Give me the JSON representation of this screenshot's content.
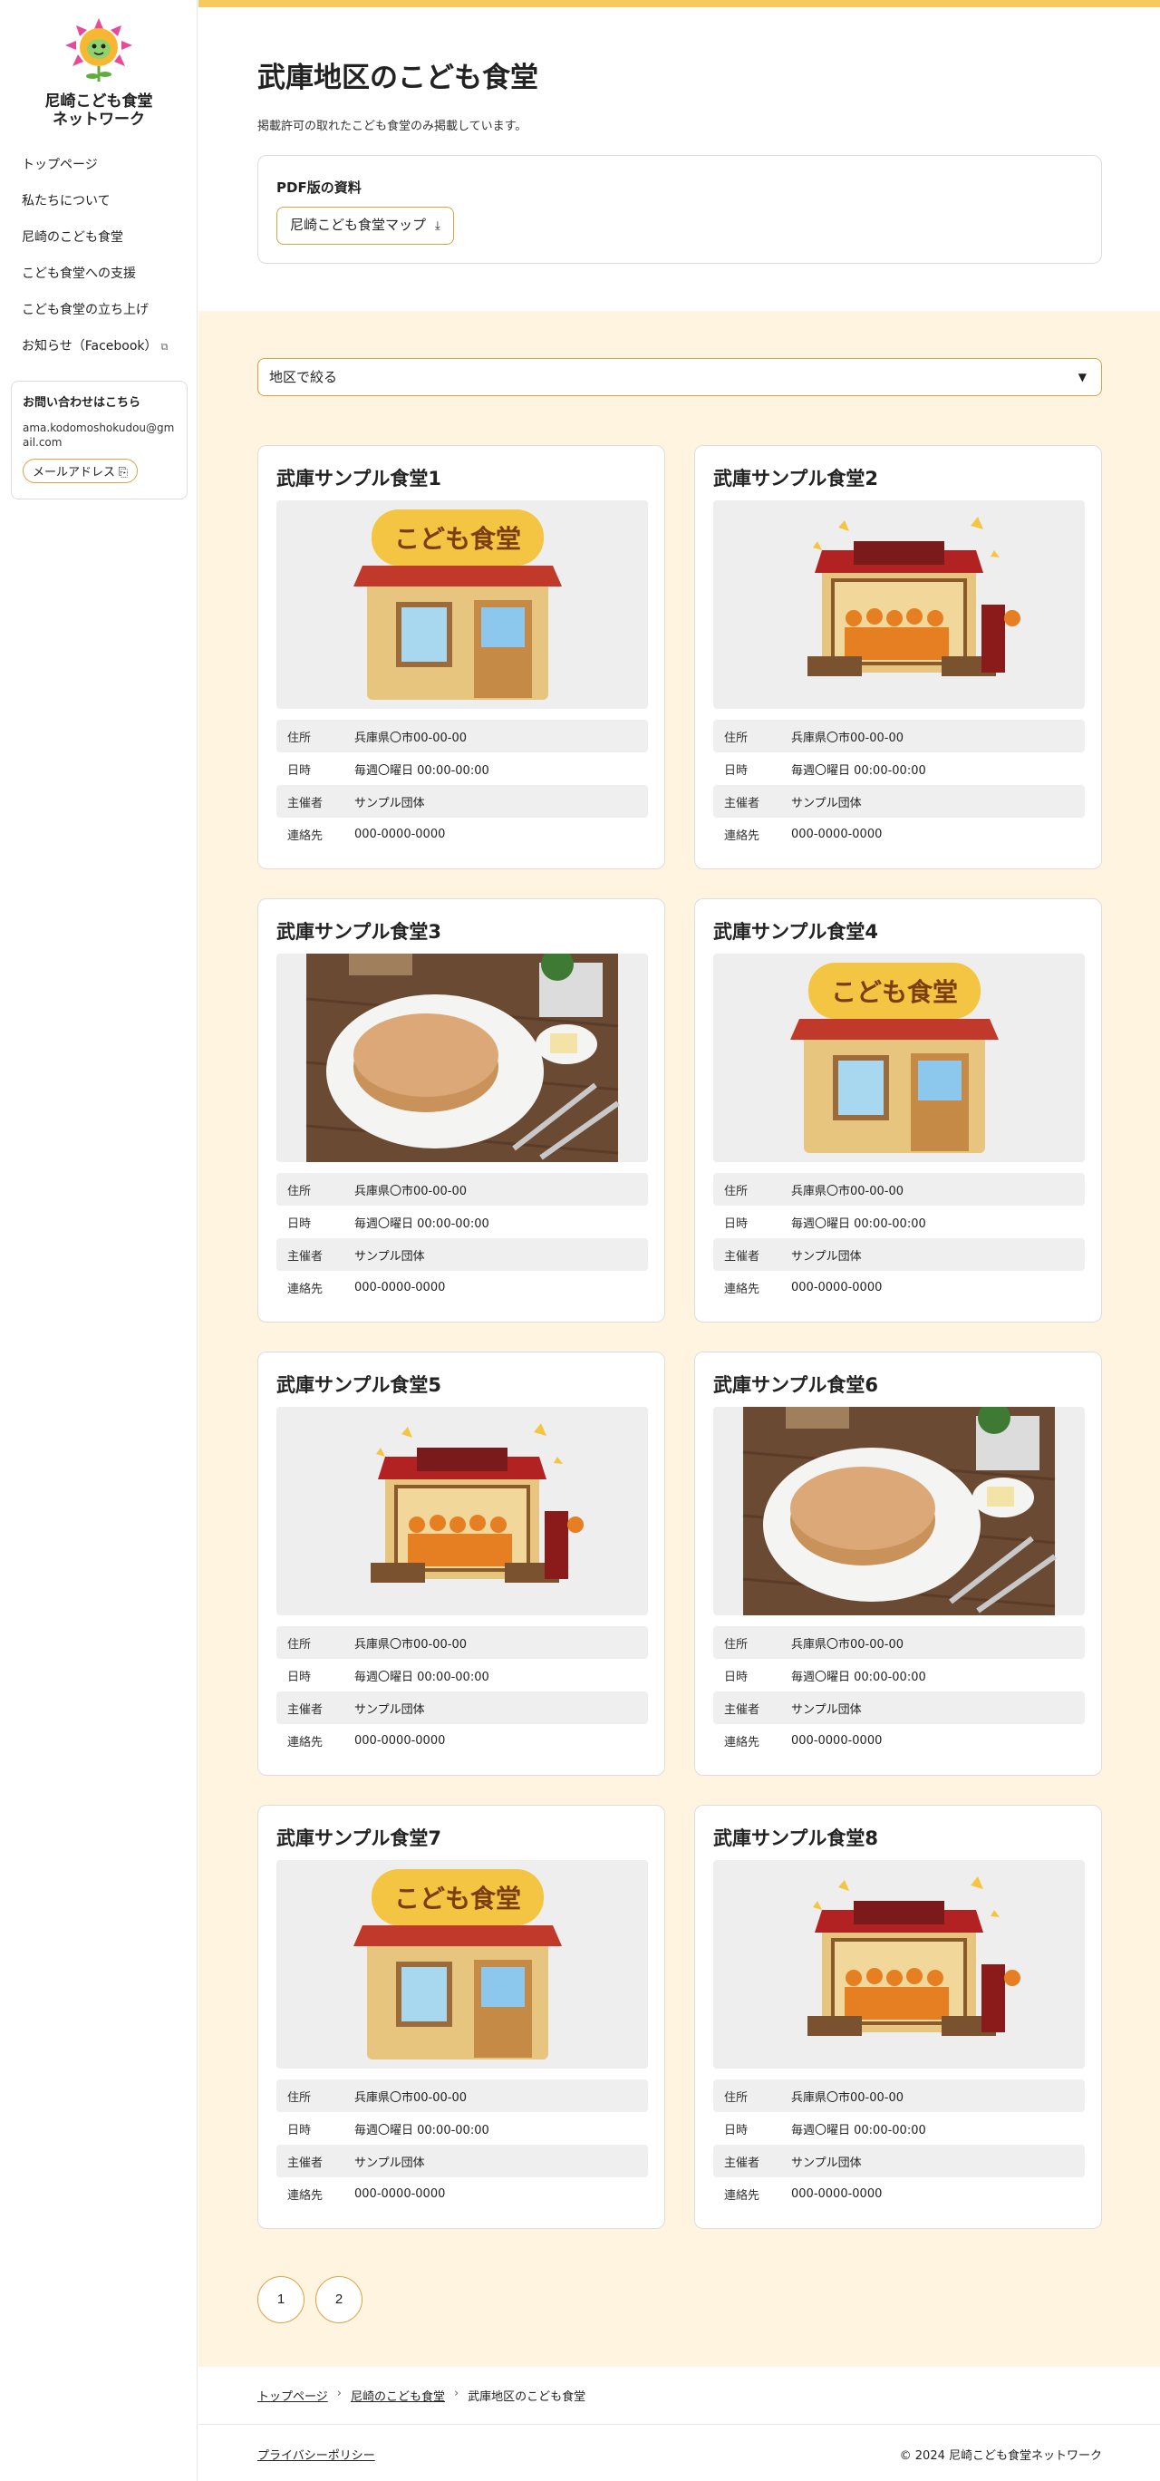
{
  "site": {
    "name_line1": "尼崎こども食堂",
    "name_line2": "ネットワーク"
  },
  "nav": {
    "items": [
      {
        "label": "トップページ"
      },
      {
        "label": "私たちについて"
      },
      {
        "label": "尼崎のこども食堂"
      },
      {
        "label": "こども食堂への支援"
      },
      {
        "label": "こども食堂の立ち上げ"
      },
      {
        "label": "お知らせ（Facebook）"
      }
    ],
    "external_icon": "external-link-icon"
  },
  "contact": {
    "title": "お問い合わせはこちら",
    "email": "ama.kodomoshokudou@gmail.com",
    "button_label": "メールアドレス",
    "button_icon": "copy-icon"
  },
  "page": {
    "title": "武庫地区のこども食堂",
    "subtitle": "掲載許可の取れたこども食堂のみ掲載しています。"
  },
  "pdf": {
    "title": "PDF版の資料",
    "button_label": "尼崎こども食堂マップ",
    "button_icon": "download-icon"
  },
  "filter": {
    "selected": "地区で絞る",
    "icon": "caret-down-icon"
  },
  "info_labels": {
    "address": "住所",
    "datetime": "日時",
    "organizer": "主催者",
    "contact": "連絡先"
  },
  "cards": [
    {
      "title": "武庫サンプル食堂1",
      "image": "shop-sign-illustration",
      "address": "兵庫県〇市00-00-00",
      "datetime": "毎週〇曜日 00:00-00:00",
      "organizer": "サンプル団体",
      "contact": "000-0000-0000"
    },
    {
      "title": "武庫サンプル食堂2",
      "image": "crowded-shop-illustration",
      "address": "兵庫県〇市00-00-00",
      "datetime": "毎週〇曜日 00:00-00:00",
      "organizer": "サンプル団体",
      "contact": "000-0000-0000"
    },
    {
      "title": "武庫サンプル食堂3",
      "image": "pancake-photo",
      "address": "兵庫県〇市00-00-00",
      "datetime": "毎週〇曜日 00:00-00:00",
      "organizer": "サンプル団体",
      "contact": "000-0000-0000"
    },
    {
      "title": "武庫サンプル食堂4",
      "image": "shop-sign-illustration",
      "address": "兵庫県〇市00-00-00",
      "datetime": "毎週〇曜日 00:00-00:00",
      "organizer": "サンプル団体",
      "contact": "000-0000-0000"
    },
    {
      "title": "武庫サンプル食堂5",
      "image": "crowded-shop-illustration",
      "address": "兵庫県〇市00-00-00",
      "datetime": "毎週〇曜日 00:00-00:00",
      "organizer": "サンプル団体",
      "contact": "000-0000-0000"
    },
    {
      "title": "武庫サンプル食堂6",
      "image": "pancake-photo",
      "address": "兵庫県〇市00-00-00",
      "datetime": "毎週〇曜日 00:00-00:00",
      "organizer": "サンプル団体",
      "contact": "000-0000-0000"
    },
    {
      "title": "武庫サンプル食堂7",
      "image": "shop-sign-illustration",
      "address": "兵庫県〇市00-00-00",
      "datetime": "毎週〇曜日 00:00-00:00",
      "organizer": "サンプル団体",
      "contact": "000-0000-0000"
    },
    {
      "title": "武庫サンプル食堂8",
      "image": "crowded-shop-illustration",
      "address": "兵庫県〇市00-00-00",
      "datetime": "毎週〇曜日 00:00-00:00",
      "organizer": "サンプル団体",
      "contact": "000-0000-0000"
    }
  ],
  "shop_sign_text": "こども食堂",
  "pagination": [
    "1",
    "2"
  ],
  "breadcrumb": {
    "items": [
      "トップページ",
      "尼崎のこども食堂",
      "武庫地区のこども食堂"
    ],
    "separator": "›"
  },
  "footer": {
    "privacy": "プライバシーポリシー",
    "copyright": "© 2024 尼崎こども食堂ネットワーク"
  },
  "colors": {
    "accent": "#f7c95e",
    "border_accent": "#d9a441",
    "content_bg": "#fff4e0",
    "row_bg": "#efefef"
  }
}
